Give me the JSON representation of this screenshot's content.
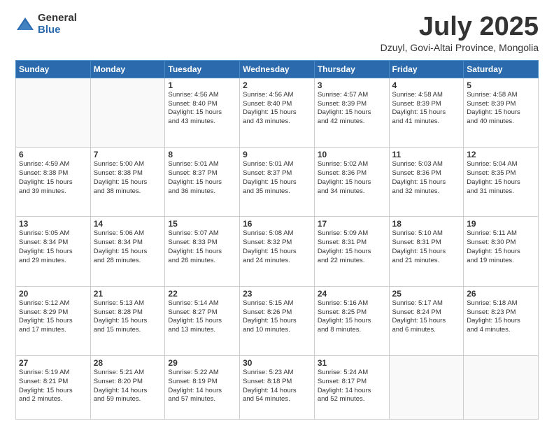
{
  "logo": {
    "general": "General",
    "blue": "Blue"
  },
  "header": {
    "month": "July 2025",
    "location": "Dzuyl, Govi-Altai Province, Mongolia"
  },
  "weekdays": [
    "Sunday",
    "Monday",
    "Tuesday",
    "Wednesday",
    "Thursday",
    "Friday",
    "Saturday"
  ],
  "weeks": [
    [
      {
        "num": "",
        "info": ""
      },
      {
        "num": "",
        "info": ""
      },
      {
        "num": "1",
        "info": "Sunrise: 4:56 AM\nSunset: 8:40 PM\nDaylight: 15 hours\nand 43 minutes."
      },
      {
        "num": "2",
        "info": "Sunrise: 4:56 AM\nSunset: 8:40 PM\nDaylight: 15 hours\nand 43 minutes."
      },
      {
        "num": "3",
        "info": "Sunrise: 4:57 AM\nSunset: 8:39 PM\nDaylight: 15 hours\nand 42 minutes."
      },
      {
        "num": "4",
        "info": "Sunrise: 4:58 AM\nSunset: 8:39 PM\nDaylight: 15 hours\nand 41 minutes."
      },
      {
        "num": "5",
        "info": "Sunrise: 4:58 AM\nSunset: 8:39 PM\nDaylight: 15 hours\nand 40 minutes."
      }
    ],
    [
      {
        "num": "6",
        "info": "Sunrise: 4:59 AM\nSunset: 8:38 PM\nDaylight: 15 hours\nand 39 minutes."
      },
      {
        "num": "7",
        "info": "Sunrise: 5:00 AM\nSunset: 8:38 PM\nDaylight: 15 hours\nand 38 minutes."
      },
      {
        "num": "8",
        "info": "Sunrise: 5:01 AM\nSunset: 8:37 PM\nDaylight: 15 hours\nand 36 minutes."
      },
      {
        "num": "9",
        "info": "Sunrise: 5:01 AM\nSunset: 8:37 PM\nDaylight: 15 hours\nand 35 minutes."
      },
      {
        "num": "10",
        "info": "Sunrise: 5:02 AM\nSunset: 8:36 PM\nDaylight: 15 hours\nand 34 minutes."
      },
      {
        "num": "11",
        "info": "Sunrise: 5:03 AM\nSunset: 8:36 PM\nDaylight: 15 hours\nand 32 minutes."
      },
      {
        "num": "12",
        "info": "Sunrise: 5:04 AM\nSunset: 8:35 PM\nDaylight: 15 hours\nand 31 minutes."
      }
    ],
    [
      {
        "num": "13",
        "info": "Sunrise: 5:05 AM\nSunset: 8:34 PM\nDaylight: 15 hours\nand 29 minutes."
      },
      {
        "num": "14",
        "info": "Sunrise: 5:06 AM\nSunset: 8:34 PM\nDaylight: 15 hours\nand 28 minutes."
      },
      {
        "num": "15",
        "info": "Sunrise: 5:07 AM\nSunset: 8:33 PM\nDaylight: 15 hours\nand 26 minutes."
      },
      {
        "num": "16",
        "info": "Sunrise: 5:08 AM\nSunset: 8:32 PM\nDaylight: 15 hours\nand 24 minutes."
      },
      {
        "num": "17",
        "info": "Sunrise: 5:09 AM\nSunset: 8:31 PM\nDaylight: 15 hours\nand 22 minutes."
      },
      {
        "num": "18",
        "info": "Sunrise: 5:10 AM\nSunset: 8:31 PM\nDaylight: 15 hours\nand 21 minutes."
      },
      {
        "num": "19",
        "info": "Sunrise: 5:11 AM\nSunset: 8:30 PM\nDaylight: 15 hours\nand 19 minutes."
      }
    ],
    [
      {
        "num": "20",
        "info": "Sunrise: 5:12 AM\nSunset: 8:29 PM\nDaylight: 15 hours\nand 17 minutes."
      },
      {
        "num": "21",
        "info": "Sunrise: 5:13 AM\nSunset: 8:28 PM\nDaylight: 15 hours\nand 15 minutes."
      },
      {
        "num": "22",
        "info": "Sunrise: 5:14 AM\nSunset: 8:27 PM\nDaylight: 15 hours\nand 13 minutes."
      },
      {
        "num": "23",
        "info": "Sunrise: 5:15 AM\nSunset: 8:26 PM\nDaylight: 15 hours\nand 10 minutes."
      },
      {
        "num": "24",
        "info": "Sunrise: 5:16 AM\nSunset: 8:25 PM\nDaylight: 15 hours\nand 8 minutes."
      },
      {
        "num": "25",
        "info": "Sunrise: 5:17 AM\nSunset: 8:24 PM\nDaylight: 15 hours\nand 6 minutes."
      },
      {
        "num": "26",
        "info": "Sunrise: 5:18 AM\nSunset: 8:23 PM\nDaylight: 15 hours\nand 4 minutes."
      }
    ],
    [
      {
        "num": "27",
        "info": "Sunrise: 5:19 AM\nSunset: 8:21 PM\nDaylight: 15 hours\nand 2 minutes."
      },
      {
        "num": "28",
        "info": "Sunrise: 5:21 AM\nSunset: 8:20 PM\nDaylight: 14 hours\nand 59 minutes."
      },
      {
        "num": "29",
        "info": "Sunrise: 5:22 AM\nSunset: 8:19 PM\nDaylight: 14 hours\nand 57 minutes."
      },
      {
        "num": "30",
        "info": "Sunrise: 5:23 AM\nSunset: 8:18 PM\nDaylight: 14 hours\nand 54 minutes."
      },
      {
        "num": "31",
        "info": "Sunrise: 5:24 AM\nSunset: 8:17 PM\nDaylight: 14 hours\nand 52 minutes."
      },
      {
        "num": "",
        "info": ""
      },
      {
        "num": "",
        "info": ""
      }
    ]
  ]
}
